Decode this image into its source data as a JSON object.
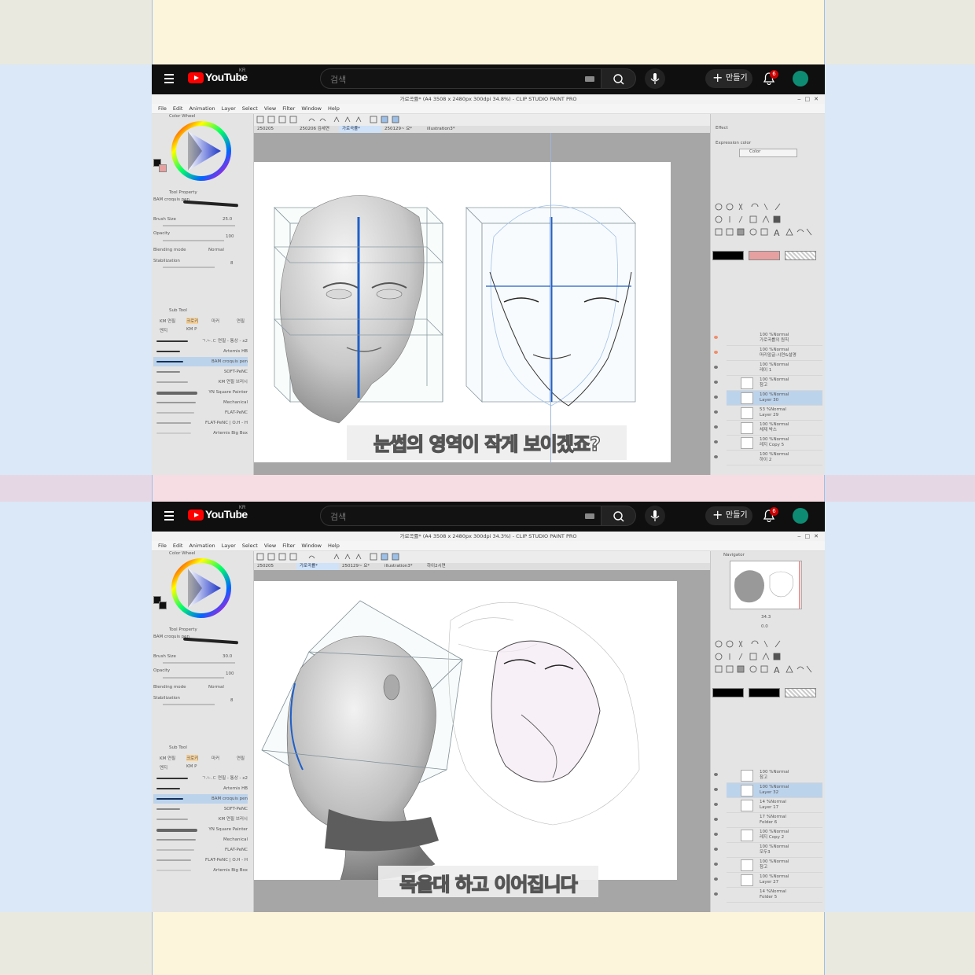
{
  "colors": {
    "outer_gray": "#e9e9df",
    "cream": "#fdf4dc",
    "pale_blue": "#dbe8f7",
    "pink_band": "#f6dde3",
    "lilac": "#e6d7e4",
    "youtube_red": "#ff0000",
    "avatar": "#0d8c73"
  },
  "youtube": {
    "brand": "YouTube",
    "region": "KR",
    "search_placeholder": "검색",
    "create_label": "만들기",
    "notification_count": "6",
    "icons": [
      "menu-icon",
      "search-icon",
      "keyboard-icon",
      "mic-icon",
      "bell-icon"
    ]
  },
  "csp_menu": [
    "File",
    "Edit",
    "Animation",
    "Layer",
    "Select",
    "View",
    "Filter",
    "Window",
    "Help"
  ],
  "frame1": {
    "window_title": "가로곡률* (A4 3508 x 2480px 300dpi 34.8%) - CLIP STUDIO PAINT PRO",
    "tabs": [
      {
        "label": "250205",
        "active": false
      },
      {
        "label": "250206 김세연",
        "active": false
      },
      {
        "label": "가로곡률*",
        "active": true
      },
      {
        "label": "250129~ 요*",
        "active": false
      },
      {
        "label": "illustration3*",
        "active": false
      }
    ],
    "color_wheel_label": "Color Wheel",
    "tool_property_label": "Tool Property",
    "brush_name": "BAM croquis pen",
    "brush_size_label": "Brush Size",
    "brush_size": "25.0",
    "opacity_label": "Opacity",
    "opacity": "100",
    "blending_label": "Blending mode",
    "blending_value": "Normal",
    "stabilization_label": "Stabilization",
    "stabilization": "8",
    "subtool_label": "Sub Tool",
    "subtitle": "눈썹의 영역이 작게 보이겠죠?",
    "right_top": {
      "effect_label": "Effect",
      "expression_label": "Expression color",
      "expression_value": "Color"
    },
    "layers": [
      {
        "mode": "100 %Normal",
        "name": "가로곡률의 원칙"
      },
      {
        "mode": "100 %Normal",
        "name": "머리앞글-시연&설명"
      },
      {
        "mode": "100 %Normal",
        "name": "레이 1"
      },
      {
        "mode": "100 %Normal",
        "name": "참고"
      },
      {
        "mode": "100 %Normal",
        "name": "Layer 30",
        "selected": true
      },
      {
        "mode": "53 %Normal",
        "name": "Layer 29"
      },
      {
        "mode": "100 %Normal",
        "name": "체제 박스"
      },
      {
        "mode": "100 %Normal",
        "name": "레지 Copy 5"
      },
      {
        "mode": "100 %Normal",
        "name": "하이 2"
      }
    ]
  },
  "frame2": {
    "window_title": "가로곡률* (A4 3508 x 2480px 300dpi 34.3%) - CLIP STUDIO PAINT PRO",
    "tabs": [
      {
        "label": "250205",
        "active": false
      },
      {
        "label": "가로곡률*",
        "active": true
      },
      {
        "label": "250129~ 요*",
        "active": false
      },
      {
        "label": "illustration3*",
        "active": false
      },
      {
        "label": "하이2시연",
        "active": false
      }
    ],
    "brush_size": "30.0",
    "opacity": "100",
    "blending_value": "Normal",
    "stabilization": "8",
    "navigator_label": "Navigator",
    "zoom": "34.3",
    "rotation": "0.0",
    "subtitle": "목울대 하고 이어집니다",
    "layers": [
      {
        "mode": "100 %Normal",
        "name": "참고"
      },
      {
        "mode": "100 %Normal",
        "name": "Layer 32",
        "selected": true
      },
      {
        "mode": "14 %Normal",
        "name": "Layer 17"
      },
      {
        "mode": "17 %Normal",
        "name": "Folder 6"
      },
      {
        "mode": "100 %Normal",
        "name": "레지 Copy 2"
      },
      {
        "mode": "100 %Normal",
        "name": "모두3"
      },
      {
        "mode": "100 %Normal",
        "name": "참고"
      },
      {
        "mode": "100 %Normal",
        "name": "Layer 27"
      },
      {
        "mode": "14 %Normal",
        "name": "Folder 5"
      }
    ]
  },
  "brushes": [
    "ㄱ.ㄴ.ㄷ 연필 - 통상 - x2",
    "Artemis HB",
    "BAM croquis pen",
    "SOFT-PeNC",
    "KM 연필 브러시",
    "YN Square Painter",
    "Mechanical",
    "FLAT-PeNC",
    "FLAT-PeNC | O.H - H",
    "Artemis Big Box"
  ],
  "subtool_tabs": [
    "KM 연필",
    "크로키",
    "마커",
    "연필",
    "멘지",
    "KM P"
  ]
}
